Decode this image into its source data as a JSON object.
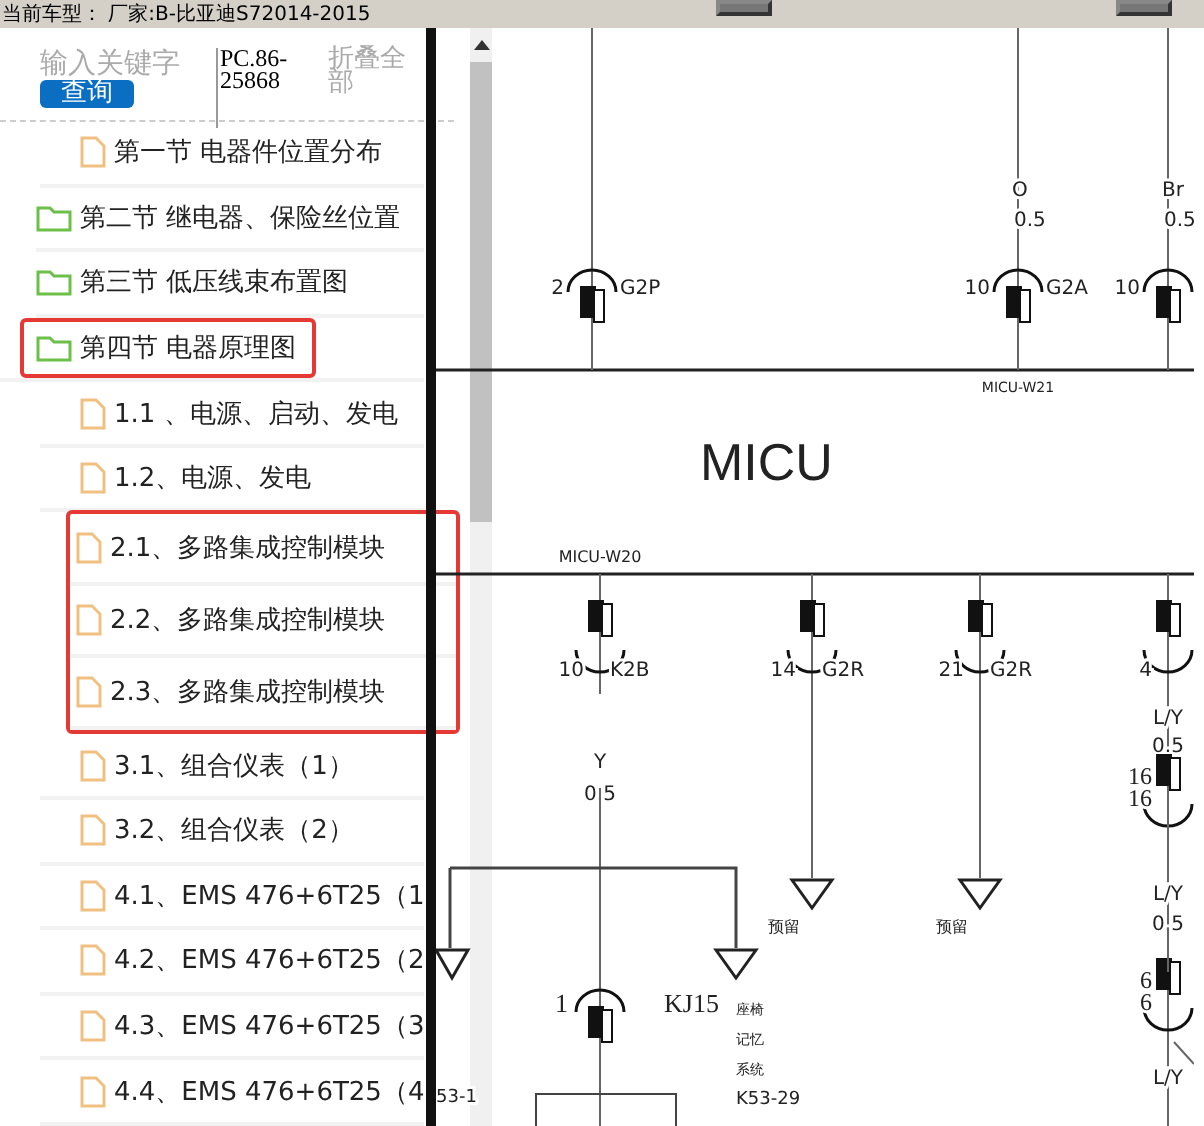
{
  "top_bar": {
    "vehicle": "当前车型：  厂家:B-比亚迪S72014-2015"
  },
  "search": {
    "placeholder": "输入关键字",
    "button": "查询",
    "phone": "PC.86-25868",
    "collapse": "折叠全部"
  },
  "tree": [
    {
      "kind": "file",
      "label": "第一节 电器件位置分布",
      "highlighted": false
    },
    {
      "kind": "folder",
      "label": "第二节 继电器、保险丝位置",
      "highlighted": false
    },
    {
      "kind": "folder",
      "label": "第三节 低压线束布置图",
      "highlighted": false
    },
    {
      "kind": "folder",
      "label": "第四节 电器原理图",
      "highlighted": true,
      "children": [
        {
          "label": "1.1 、电源、启动、发电",
          "highlighted": false
        },
        {
          "label": "1.2、电源、发电",
          "highlighted": false
        },
        {
          "label": "2.1、多路集成控制模块",
          "highlighted": true
        },
        {
          "label": "2.2、多路集成控制模块",
          "highlighted": true
        },
        {
          "label": "2.3、多路集成控制模块",
          "highlighted": true
        },
        {
          "label": "3.1、组合仪表（1）",
          "highlighted": false
        },
        {
          "label": "3.2、组合仪表（2）",
          "highlighted": false
        },
        {
          "label": "4.1、EMS 476+6T25（1",
          "highlighted": false
        },
        {
          "label": "4.2、EMS 476+6T25（2",
          "highlighted": false
        },
        {
          "label": "4.3、EMS 476+6T25（3",
          "highlighted": false
        },
        {
          "label": "4.4、EMS 476+6T25（4",
          "highlighted": false
        }
      ]
    }
  ],
  "diagram": {
    "module": "MICU",
    "top_connectors": [
      {
        "pin": "2",
        "code": "G2P"
      },
      {
        "pin": "10",
        "code": "G2A",
        "wire": "O",
        "gauge": "0.5",
        "label": "MICU-W21"
      },
      {
        "pin": "10",
        "wire": "Br",
        "gauge": "0.5"
      }
    ],
    "bottom_connectors": [
      {
        "pin": "10",
        "code": "K2B",
        "label": "MICU-W20",
        "wire": "Y",
        "gauge": "0.5"
      },
      {
        "pin": "14",
        "code": "G2R",
        "note": "预留"
      },
      {
        "pin": "21",
        "code": "G2R",
        "note": "预留"
      },
      {
        "pin": "4",
        "wire": "L/Y",
        "gauge": "0.5"
      }
    ],
    "seat_connector": {
      "pin": "1",
      "code": "KJ15",
      "lines": [
        "座椅",
        "记忆",
        "系统"
      ],
      "part": "K53-29",
      "left_part": "53-1"
    },
    "right_chain": [
      {
        "pins": [
          "16",
          "16"
        ],
        "wire": "L/Y",
        "gauge": "0.5"
      },
      {
        "pins": [
          "6",
          "6"
        ],
        "wire": "L/Y"
      }
    ]
  }
}
